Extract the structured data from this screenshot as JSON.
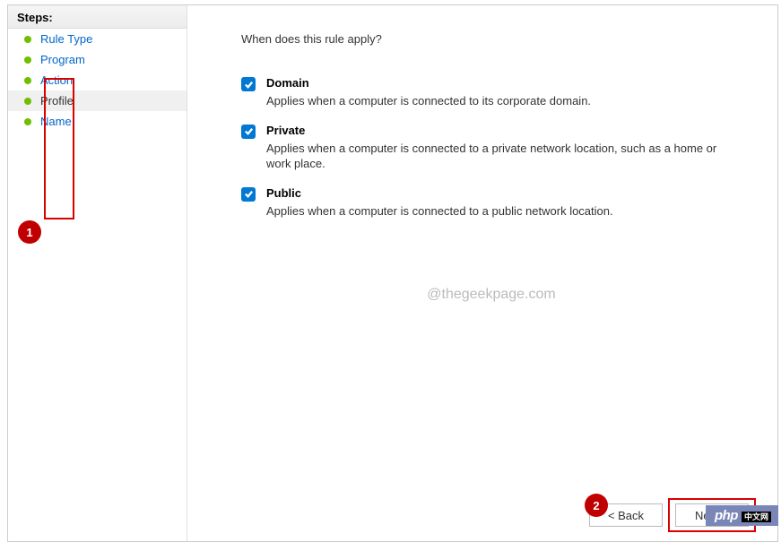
{
  "sidebar": {
    "header": "Steps:",
    "items": [
      {
        "label": "Rule Type",
        "active": false
      },
      {
        "label": "Program",
        "active": false
      },
      {
        "label": "Action",
        "active": false
      },
      {
        "label": "Profile",
        "active": true
      },
      {
        "label": "Name",
        "active": false
      }
    ]
  },
  "main": {
    "question": "When does this rule apply?",
    "options": [
      {
        "checked": true,
        "title": "Domain",
        "desc": "Applies when a computer is connected to its corporate domain."
      },
      {
        "checked": true,
        "title": "Private",
        "desc": "Applies when a computer is connected to a private network location, such as a home or work place."
      },
      {
        "checked": true,
        "title": "Public",
        "desc": "Applies when a computer is connected to a public network location."
      }
    ],
    "watermark": "@thegeekpage.com"
  },
  "buttons": {
    "back": "< Back",
    "next": "Next >"
  },
  "callouts": {
    "one": "1",
    "two": "2"
  },
  "php": {
    "text": "php",
    "cn": "中文网"
  }
}
